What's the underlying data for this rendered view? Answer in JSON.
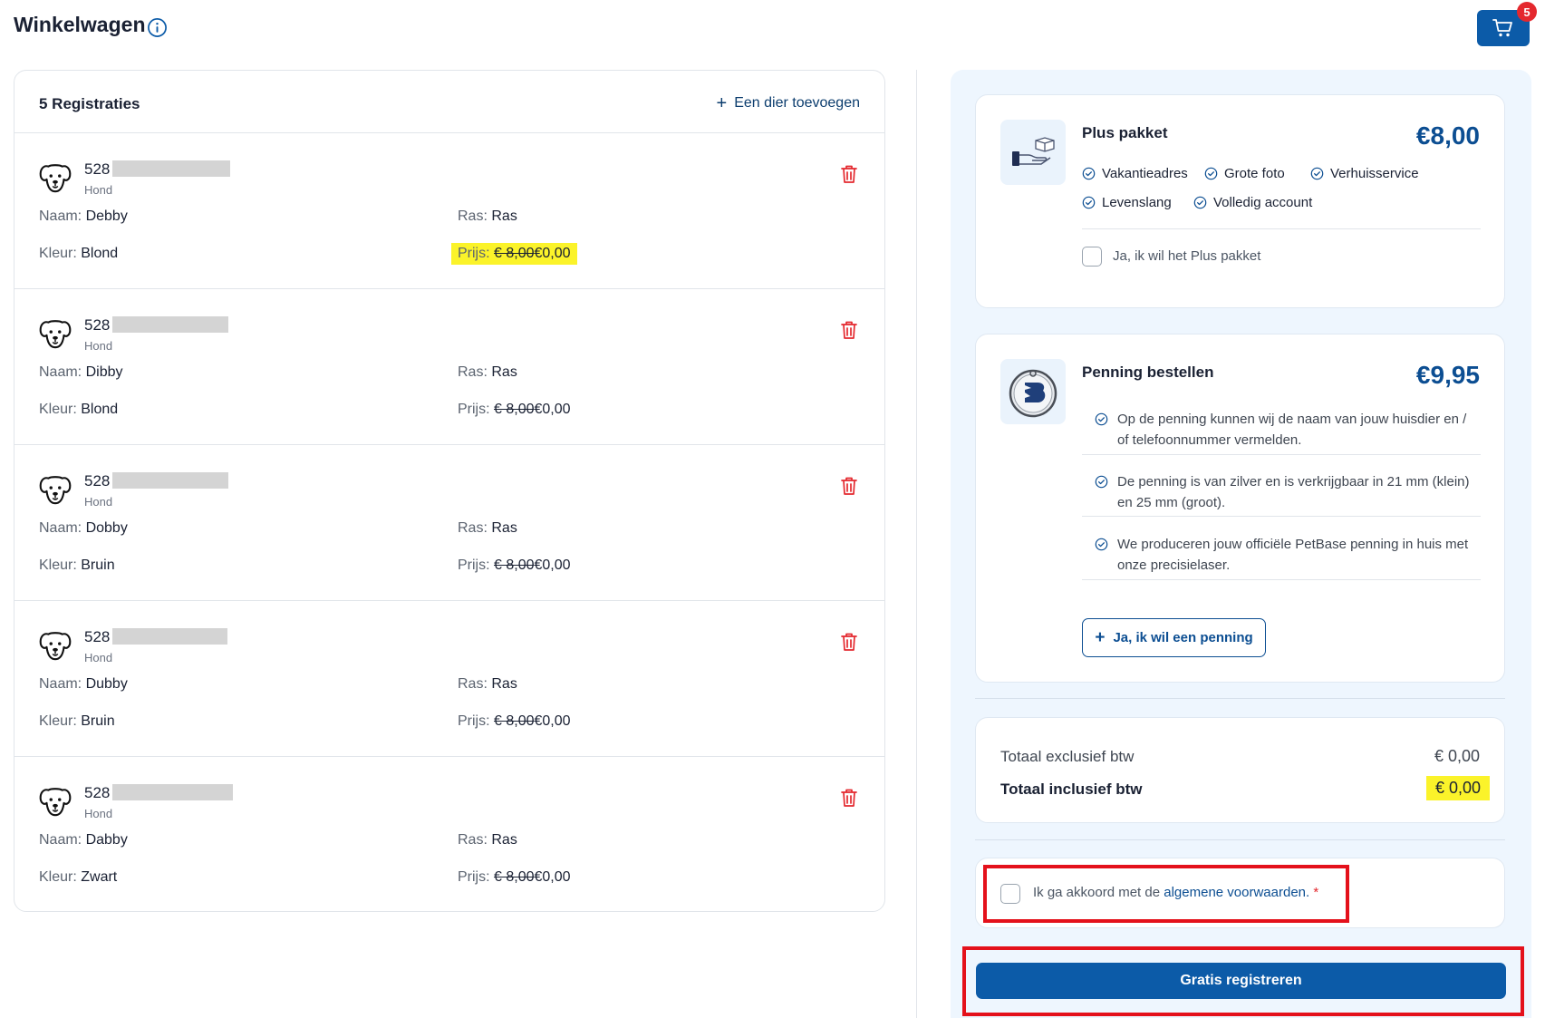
{
  "header": {
    "title": "Winkelwagen",
    "cart_count": "5",
    "info_icon": "info-circle-icon",
    "cart_icon": "shopping-cart-icon"
  },
  "registrations": {
    "count_label": "5 Registraties",
    "add_label": "Een dier toevoegen",
    "field_labels": {
      "name": "Naam:",
      "color": "Kleur:",
      "breed": "Ras:",
      "price": "Prijs:"
    },
    "items": [
      {
        "chip": "528",
        "species": "Hond",
        "name": "Debby",
        "color": "Blond",
        "breed": "Ras",
        "old_price": "€ 8,00",
        "price": "€0,00",
        "highlighted": true
      },
      {
        "chip": "528",
        "species": "Hond",
        "name": "Dibby",
        "color": "Blond",
        "breed": "Ras",
        "old_price": "€ 8,00",
        "price": "€0,00",
        "highlighted": false
      },
      {
        "chip": "528",
        "species": "Hond",
        "name": "Dobby",
        "color": "Bruin",
        "breed": "Ras",
        "old_price": "€ 8,00",
        "price": "€0,00",
        "highlighted": false
      },
      {
        "chip": "528",
        "species": "Hond",
        "name": "Dubby",
        "color": "Bruin",
        "breed": "Ras",
        "old_price": "€ 8,00",
        "price": "€0,00",
        "highlighted": false
      },
      {
        "chip": "528",
        "species": "Hond",
        "name": "Dabby",
        "color": "Zwart",
        "breed": "Ras",
        "old_price": "€ 8,00",
        "price": "€0,00",
        "highlighted": false
      }
    ]
  },
  "plus_package": {
    "title": "Plus pakket",
    "price": "€8,00",
    "features": [
      "Vakantieadres",
      "Grote foto",
      "Verhuisservice",
      "Levenslang",
      "Volledig account"
    ],
    "checkbox_label": "Ja, ik wil het Plus pakket"
  },
  "penning": {
    "title": "Penning bestellen",
    "price": "€9,95",
    "features": [
      "Op de penning kunnen wij de naam van jouw huisdier en / of telefoonnummer vermelden.",
      "De penning is van zilver en is verkrijgbaar in 21 mm (klein) en 25 mm (groot).",
      "We produceren jouw officiële PetBase penning in huis met onze precisielaser."
    ],
    "button_label": "Ja, ik wil een penning"
  },
  "totals": {
    "excl_label": "Totaal exclusief btw",
    "excl_value": "€ 0,00",
    "incl_label": "Totaal inclusief btw",
    "incl_value": "€ 0,00"
  },
  "terms": {
    "prefix": "Ik ga akkoord met de",
    "link": "algemene voorwaarden.",
    "required_mark": "*"
  },
  "submit_label": "Gratis registreren",
  "colors": {
    "primary": "#0c5ba8",
    "price_blue": "#0c4e92",
    "highlight": "#fbf32a",
    "annotation_red": "#e4111b",
    "trash_red": "#e4282e",
    "panel_bg": "#eef6fe"
  }
}
